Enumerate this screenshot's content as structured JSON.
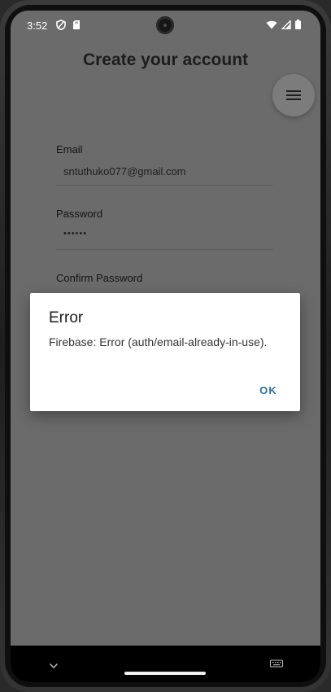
{
  "status_bar": {
    "time": "3:52",
    "left_icons": [
      "shield-icon",
      "sd-card-icon"
    ],
    "right_icons": [
      "wifi-icon",
      "signal-icon",
      "battery-icon"
    ]
  },
  "page": {
    "title": "Create your account",
    "menu_icon": "hamburger-menu-icon"
  },
  "form": {
    "email": {
      "label": "Email",
      "value": "sntuthuko077@gmail.com"
    },
    "password": {
      "label": "Password",
      "value": "••••••"
    },
    "confirm_password": {
      "label": "Confirm Password",
      "value": ""
    }
  },
  "dialog": {
    "title": "Error",
    "message": "Firebase: Error (auth/email-already-in-use).",
    "ok_label": "OK"
  },
  "colors": {
    "dialog_button": "#2d6e9a",
    "scrim": "#6b6b6b"
  }
}
